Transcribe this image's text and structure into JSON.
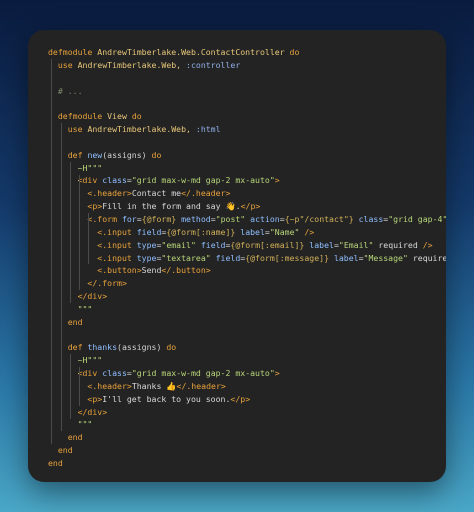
{
  "editor": {
    "lines": [
      [
        {
          "t": "defmodule",
          "c": "kw"
        },
        {
          "t": " AndrewTimberlake.Web.ContactController ",
          "c": "mod"
        },
        {
          "t": "do",
          "c": "kw"
        }
      ],
      [
        {
          "t": "  use",
          "c": "kw"
        },
        {
          "t": " AndrewTimberlake.Web, ",
          "c": "mod"
        },
        {
          "t": ":controller",
          "c": "atom"
        }
      ],
      [],
      [
        {
          "t": "  # ...",
          "c": "comment"
        }
      ],
      [],
      [
        {
          "t": "  defmodule",
          "c": "kw"
        },
        {
          "t": " View ",
          "c": "mod"
        },
        {
          "t": "do",
          "c": "kw"
        }
      ],
      [
        {
          "t": "    use",
          "c": "kw"
        },
        {
          "t": " AndrewTimberlake.Web, ",
          "c": "mod"
        },
        {
          "t": ":html",
          "c": "atom"
        }
      ],
      [],
      [
        {
          "t": "    def ",
          "c": "kw"
        },
        {
          "t": "new",
          "c": "fn"
        },
        {
          "t": "(assigns) ",
          "c": "sig"
        },
        {
          "t": "do",
          "c": "kw"
        }
      ],
      [
        {
          "t": "      ~H\"\"\"",
          "c": "str"
        }
      ],
      [
        {
          "t": "      <div ",
          "c": "tag"
        },
        {
          "t": "class",
          "c": "attr"
        },
        {
          "t": "=",
          "c": "plain"
        },
        {
          "t": "\"grid max-w-md gap-2 mx-auto\"",
          "c": "str"
        },
        {
          "t": ">",
          "c": "tag"
        }
      ],
      [
        {
          "t": "        <.header>",
          "c": "tag"
        },
        {
          "t": "Contact me",
          "c": "plain"
        },
        {
          "t": "</.header>",
          "c": "tag"
        }
      ],
      [
        {
          "t": "        <p>",
          "c": "tag"
        },
        {
          "t": "Fill in the form and say 👋.",
          "c": "plain"
        },
        {
          "t": "</p>",
          "c": "tag"
        }
      ],
      [
        {
          "t": "        <.form ",
          "c": "tag"
        },
        {
          "t": "for",
          "c": "attr"
        },
        {
          "t": "=",
          "c": "plain"
        },
        {
          "t": "{@form}",
          "c": "brace"
        },
        {
          "t": " method",
          "c": "attr"
        },
        {
          "t": "=",
          "c": "plain"
        },
        {
          "t": "\"post\"",
          "c": "str"
        },
        {
          "t": " action",
          "c": "attr"
        },
        {
          "t": "=",
          "c": "plain"
        },
        {
          "t": "{~p\"/contact\"}",
          "c": "brace"
        },
        {
          "t": " class",
          "c": "attr"
        },
        {
          "t": "=",
          "c": "plain"
        },
        {
          "t": "\"grid gap-4\"",
          "c": "str"
        },
        {
          "t": ">",
          "c": "tag"
        }
      ],
      [
        {
          "t": "          <.input ",
          "c": "tag"
        },
        {
          "t": "field",
          "c": "attr"
        },
        {
          "t": "=",
          "c": "plain"
        },
        {
          "t": "{@form[:name]}",
          "c": "brace"
        },
        {
          "t": " label",
          "c": "attr"
        },
        {
          "t": "=",
          "c": "plain"
        },
        {
          "t": "\"Name\"",
          "c": "str"
        },
        {
          "t": " />",
          "c": "tag"
        }
      ],
      [
        {
          "t": "          <.input ",
          "c": "tag"
        },
        {
          "t": "type",
          "c": "attr"
        },
        {
          "t": "=",
          "c": "plain"
        },
        {
          "t": "\"email\"",
          "c": "str"
        },
        {
          "t": " field",
          "c": "attr"
        },
        {
          "t": "=",
          "c": "plain"
        },
        {
          "t": "{@form[:email]}",
          "c": "brace"
        },
        {
          "t": " label",
          "c": "attr"
        },
        {
          "t": "=",
          "c": "plain"
        },
        {
          "t": "\"Email\"",
          "c": "str"
        },
        {
          "t": " required",
          "c": "plain"
        },
        {
          "t": " />",
          "c": "tag"
        }
      ],
      [
        {
          "t": "          <.input ",
          "c": "tag"
        },
        {
          "t": "type",
          "c": "attr"
        },
        {
          "t": "=",
          "c": "plain"
        },
        {
          "t": "\"textarea\"",
          "c": "str"
        },
        {
          "t": " field",
          "c": "attr"
        },
        {
          "t": "=",
          "c": "plain"
        },
        {
          "t": "{@form[:message]}",
          "c": "brace"
        },
        {
          "t": " label",
          "c": "attr"
        },
        {
          "t": "=",
          "c": "plain"
        },
        {
          "t": "\"Message\"",
          "c": "str"
        },
        {
          "t": " required",
          "c": "plain"
        },
        {
          "t": " />",
          "c": "tag"
        }
      ],
      [
        {
          "t": "          <.button>",
          "c": "tag"
        },
        {
          "t": "Send",
          "c": "plain"
        },
        {
          "t": "</.button>",
          "c": "tag"
        }
      ],
      [
        {
          "t": "        </.form>",
          "c": "tag"
        }
      ],
      [
        {
          "t": "      </div>",
          "c": "tag"
        }
      ],
      [
        {
          "t": "      \"\"\"",
          "c": "str"
        }
      ],
      [
        {
          "t": "    end",
          "c": "kw"
        }
      ],
      [],
      [
        {
          "t": "    def ",
          "c": "kw"
        },
        {
          "t": "thanks",
          "c": "fn"
        },
        {
          "t": "(assigns) ",
          "c": "sig"
        },
        {
          "t": "do",
          "c": "kw"
        }
      ],
      [
        {
          "t": "      ~H\"\"\"",
          "c": "str"
        }
      ],
      [
        {
          "t": "      <div ",
          "c": "tag"
        },
        {
          "t": "class",
          "c": "attr"
        },
        {
          "t": "=",
          "c": "plain"
        },
        {
          "t": "\"grid max-w-md gap-2 mx-auto\"",
          "c": "str"
        },
        {
          "t": ">",
          "c": "tag"
        }
      ],
      [
        {
          "t": "        <.header>",
          "c": "tag"
        },
        {
          "t": "Thanks 👍",
          "c": "plain"
        },
        {
          "t": "</.header>",
          "c": "tag"
        }
      ],
      [
        {
          "t": "        <p>",
          "c": "tag"
        },
        {
          "t": "I'll get back to you soon.",
          "c": "plain"
        },
        {
          "t": "</p>",
          "c": "tag"
        }
      ],
      [
        {
          "t": "      </div>",
          "c": "tag"
        }
      ],
      [
        {
          "t": "      \"\"\"",
          "c": "str"
        }
      ],
      [
        {
          "t": "    end",
          "c": "kw"
        }
      ],
      [
        {
          "t": "  end",
          "c": "kw"
        }
      ],
      [
        {
          "t": "end",
          "c": "kw"
        }
      ]
    ]
  }
}
